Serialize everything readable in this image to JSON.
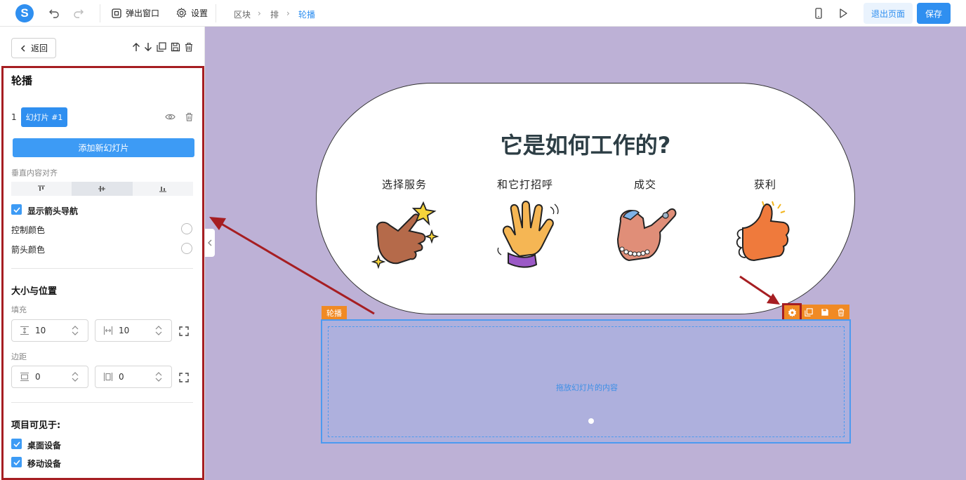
{
  "topbar": {
    "logo_letter": "S",
    "popup_label": "弹出窗口",
    "settings_label": "设置",
    "breadcrumb": [
      "区块",
      "排",
      "轮播"
    ],
    "exit_label": "退出页面",
    "save_label": "保存"
  },
  "sidebar": {
    "back_label": "返回",
    "panel_title": "轮播",
    "slide_index": "1",
    "slide_name": "幻灯片 #1",
    "add_slide_label": "添加新幻灯片",
    "vertical_align_label": "垂直内容对齐",
    "vertical_align_selected": "middle",
    "show_arrows_label": "显示箭头导航",
    "control_color_label": "控制颜色",
    "arrow_color_label": "箭头颜色",
    "size_position_title": "大小与位置",
    "padding_label": "填充",
    "padding_vertical": "10",
    "padding_horizontal": "10",
    "margin_label": "边距",
    "margin_vertical": "0",
    "margin_horizontal": "0",
    "visible_on_title": "项目可见于:",
    "desktop_label": "桌面设备",
    "mobile_label": "移动设备"
  },
  "canvas": {
    "heading": "它是如何工作的?",
    "steps": [
      "选择服务",
      "和它打招呼",
      "成交",
      "获利"
    ],
    "carousel_tag": "轮播",
    "drop_hint": "拖放幻灯片的内容"
  },
  "colors": {
    "accent": "#2f8ff0",
    "canvas_bg": "#bdb1d6",
    "toolbar_orange": "#f08a24",
    "annotation_red": "#a61e22"
  }
}
